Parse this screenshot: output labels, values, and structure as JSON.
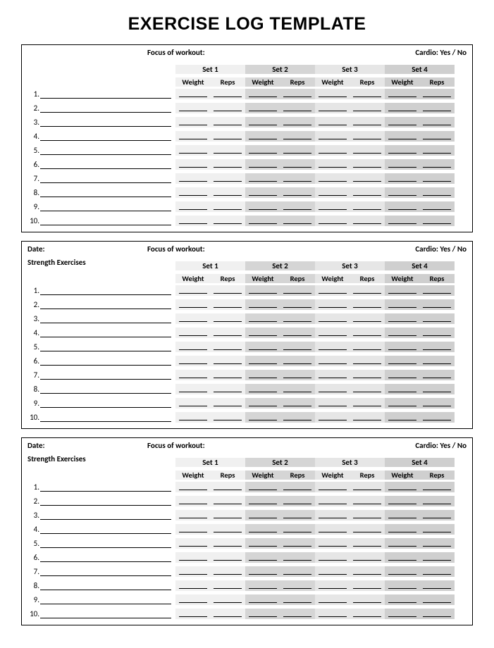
{
  "title": "EXERCISE LOG TEMPLATE",
  "labels": {
    "date": "Date:",
    "focus": "Focus of workout:",
    "cardio": "Cardio: Yes / No",
    "strength": "Strength Exercises",
    "weight": "Weight",
    "reps": "Reps"
  },
  "sets": [
    "Set 1",
    "Set 2",
    "Set 3",
    "Set 4"
  ],
  "shades": [
    "shade1",
    "shade2",
    "shade3",
    "shade4"
  ],
  "blocks": [
    {
      "showDate": false,
      "showStrengthLabel": false,
      "rows": 10
    },
    {
      "showDate": true,
      "showStrengthLabel": true,
      "rows": 10
    },
    {
      "showDate": true,
      "showStrengthLabel": true,
      "rows": 10
    }
  ]
}
